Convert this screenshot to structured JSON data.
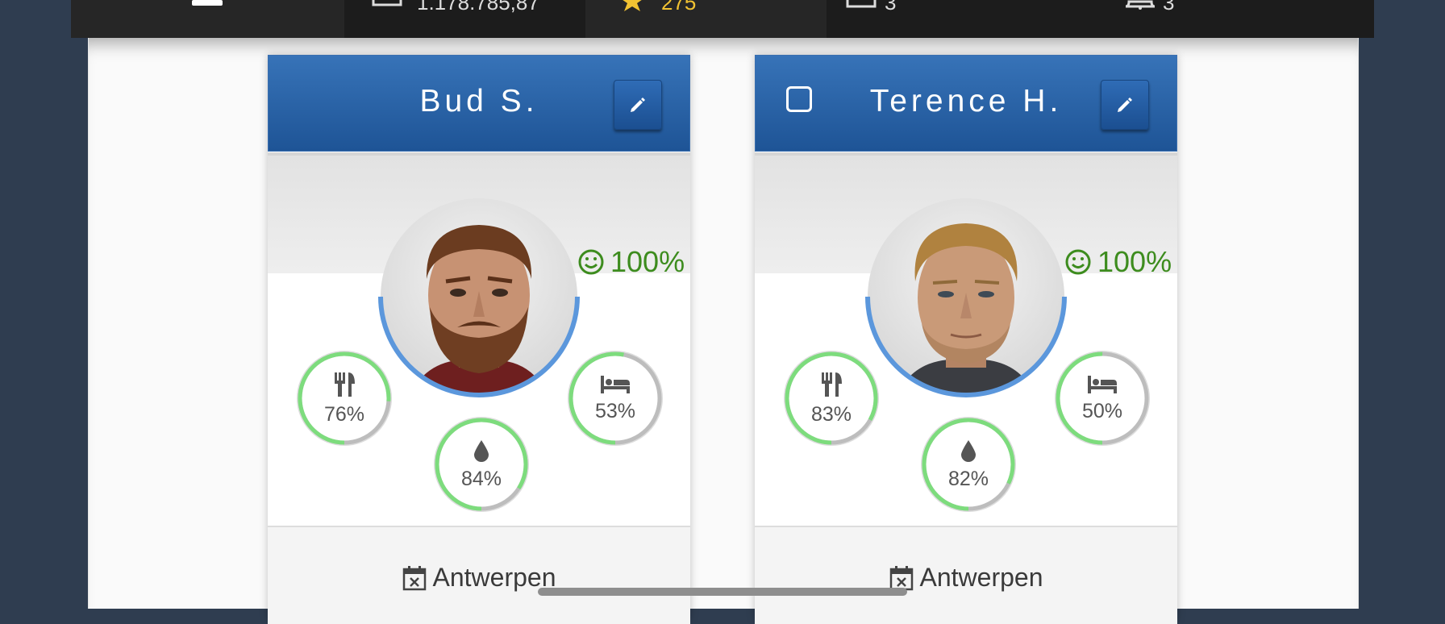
{
  "topbar": {
    "menu_icon": "menu-icon",
    "money_icon": "calendar-icon",
    "money_value": "1.178.785,87",
    "stars_icon": "star-icon",
    "stars_value": "275",
    "tasks_icon": "calendar-icon",
    "tasks_value": "3",
    "notifications_icon": "bell-icon",
    "notifications_value": "3"
  },
  "characters": [
    {
      "name": "Bud S.",
      "has_checkbox": false,
      "happiness": "100%",
      "food": "76%",
      "food_level": 0.76,
      "sleep": "53%",
      "sleep_level": 0.53,
      "water": "84%",
      "water_level": 0.84,
      "location": "Antwerpen"
    },
    {
      "name": "Terence H.",
      "has_checkbox": true,
      "happiness": "100%",
      "food": "83%",
      "food_level": 0.83,
      "sleep": "50%",
      "sleep_level": 0.5,
      "water": "82%",
      "water_level": 0.82,
      "location": "Antwerpen"
    }
  ],
  "colors": {
    "header_blue": "#2a64aa",
    "stat_green": "#7ddc7d",
    "ring_blue": "#5b97dc",
    "happy_green": "#3d8c1e",
    "star_gold": "#f1c232"
  }
}
